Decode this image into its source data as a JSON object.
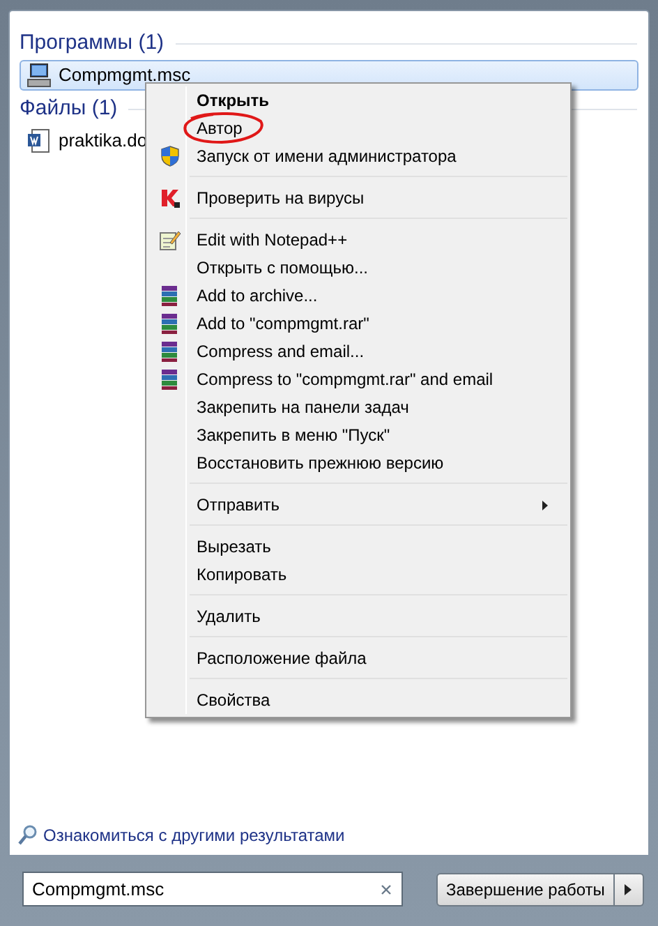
{
  "sections": [
    {
      "title": "Программы (1)",
      "items": [
        {
          "label": "Compmgmt.msc",
          "kind": "console",
          "selected": true
        }
      ]
    },
    {
      "title": "Файлы (1)",
      "items": [
        {
          "label": "praktika.do",
          "kind": "word",
          "selected": false
        }
      ]
    }
  ],
  "context_menu": {
    "groups": [
      [
        {
          "label": "Открыть",
          "bold": true,
          "circled": false
        },
        {
          "label": "Автор",
          "bold": false,
          "circled": true
        },
        {
          "label": "Запуск от имени администратора",
          "kind": "shield",
          "bold": false,
          "circled": false
        }
      ],
      [
        {
          "label": "Проверить на вирусы",
          "kind": "antivirus",
          "bold": false,
          "circled": false
        }
      ],
      [
        {
          "label": "Edit with Notepad++",
          "kind": "notepad",
          "bold": false,
          "circled": false
        },
        {
          "label": "Открыть с помощью...",
          "bold": false,
          "circled": false
        },
        {
          "label": "Add to archive...",
          "kind": "archive",
          "bold": false,
          "circled": false
        },
        {
          "label": "Add to \"compmgmt.rar\"",
          "kind": "archive",
          "bold": false,
          "circled": false
        },
        {
          "label": "Compress and email...",
          "kind": "archive",
          "bold": false,
          "circled": false
        },
        {
          "label": "Compress to \"compmgmt.rar\" and email",
          "kind": "archive",
          "bold": false,
          "circled": false
        },
        {
          "label": "Закрепить на панели задач",
          "bold": false,
          "circled": false
        },
        {
          "label": "Закрепить в меню \"Пуск\"",
          "bold": false,
          "circled": false
        },
        {
          "label": "Восстановить прежнюю версию",
          "bold": false,
          "circled": false
        }
      ],
      [
        {
          "label": "Отправить",
          "bold": false,
          "circled": false,
          "submenu": true
        }
      ],
      [
        {
          "label": "Вырезать",
          "bold": false,
          "circled": false
        },
        {
          "label": "Копировать",
          "bold": false,
          "circled": false
        }
      ],
      [
        {
          "label": "Удалить",
          "bold": false,
          "circled": false
        }
      ],
      [
        {
          "label": "Расположение файла",
          "bold": false,
          "circled": false
        }
      ],
      [
        {
          "label": "Свойства",
          "bold": false,
          "circled": false
        }
      ]
    ]
  },
  "more_results": "Ознакомиться с другими результатами",
  "search": {
    "value": "Compmgmt.msc"
  },
  "shutdown": {
    "label": "Завершение работы"
  }
}
